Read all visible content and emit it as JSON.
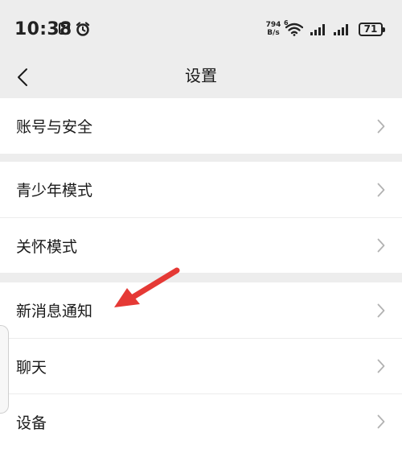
{
  "status_bar": {
    "time": "10:38",
    "net_speed_value": "794",
    "net_speed_unit": "B/s",
    "wifi_label": "6",
    "battery": "71"
  },
  "nav": {
    "title": "设置"
  },
  "groups": [
    {
      "items": [
        {
          "label": "账号与安全"
        }
      ]
    },
    {
      "items": [
        {
          "label": "青少年模式"
        },
        {
          "label": "关怀模式"
        }
      ]
    },
    {
      "items": [
        {
          "label": "新消息通知"
        },
        {
          "label": "聊天"
        },
        {
          "label": "设备"
        }
      ]
    }
  ],
  "colors": {
    "background": "#ededed",
    "surface": "#ffffff",
    "annotation_arrow": "#e53935",
    "chevron": "#b2b2b2"
  },
  "icons": {
    "back": "chevron-left-icon",
    "row_chevron": "chevron-right-icon"
  }
}
